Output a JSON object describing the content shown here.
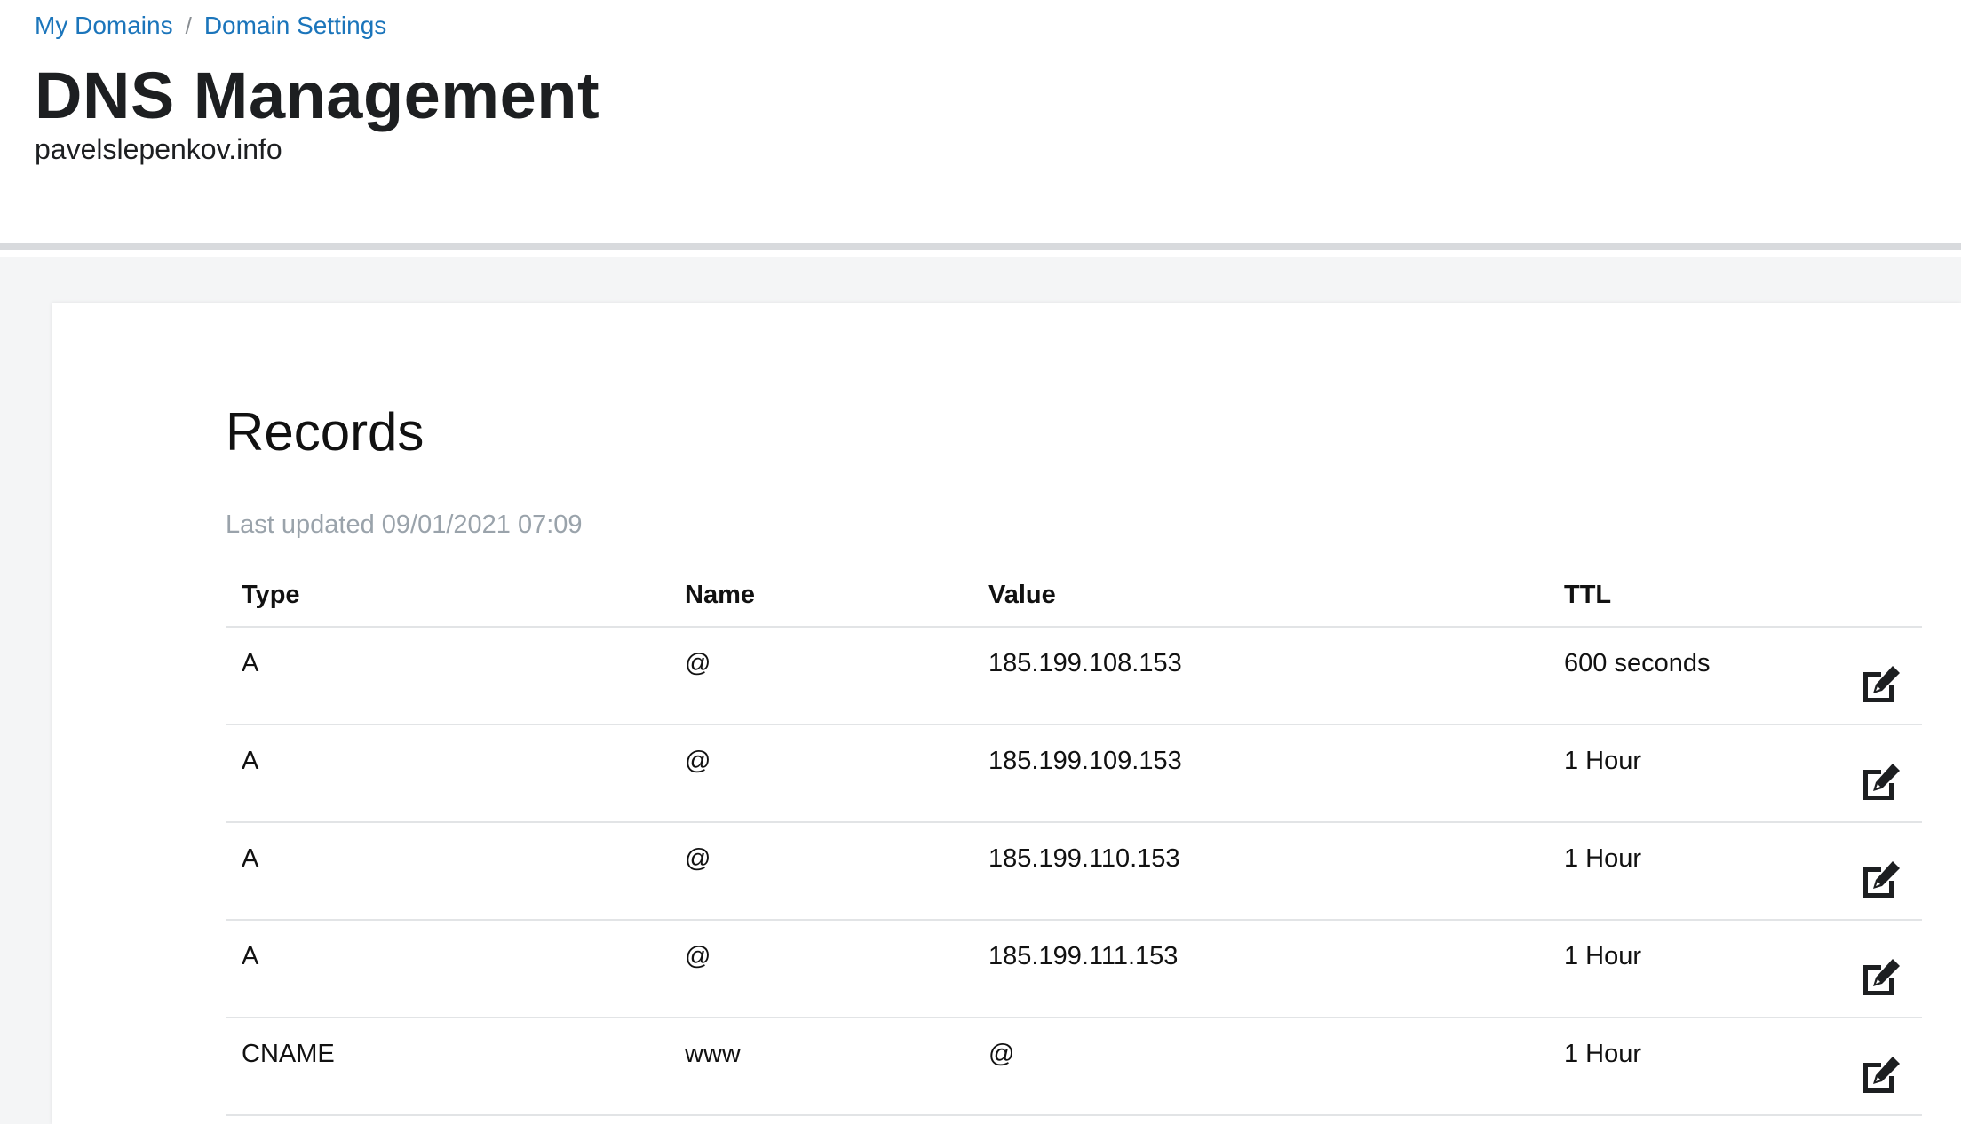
{
  "breadcrumb": {
    "items": [
      "My Domains",
      "Domain Settings"
    ],
    "separator": "/"
  },
  "page": {
    "title": "DNS Management",
    "domain": "pavelslepenkov.info"
  },
  "records": {
    "title": "Records",
    "last_updated": "Last updated 09/01/2021 07:09",
    "columns": [
      "Type",
      "Name",
      "Value",
      "TTL"
    ],
    "rows": [
      {
        "type": "A",
        "name": "@",
        "value": "185.199.108.153",
        "ttl": "600 seconds",
        "action_icon": "edit-icon"
      },
      {
        "type": "A",
        "name": "@",
        "value": "185.199.109.153",
        "ttl": "1 Hour",
        "action_icon": "edit-icon"
      },
      {
        "type": "A",
        "name": "@",
        "value": "185.199.110.153",
        "ttl": "1 Hour",
        "action_icon": "edit-icon"
      },
      {
        "type": "A",
        "name": "@",
        "value": "185.199.111.153",
        "ttl": "1 Hour",
        "action_icon": "edit-icon"
      },
      {
        "type": "CNAME",
        "name": "www",
        "value": "@",
        "ttl": "1 Hour",
        "action_icon": "edit-icon"
      }
    ]
  },
  "colors": {
    "link": "#1b75bb",
    "muted_text": "#9aa3ab",
    "content_background": "#f4f5f6",
    "divider": "#e2e4e6"
  }
}
